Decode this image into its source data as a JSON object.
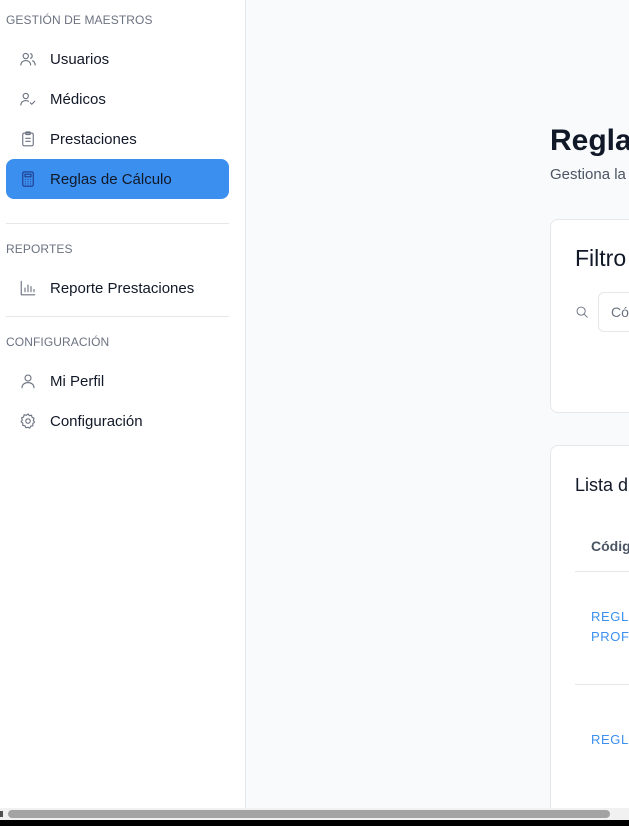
{
  "sidebar": {
    "sections": {
      "gestion": "GESTIÓN DE MAESTROS",
      "reportes": "REPORTES",
      "configuracion": "CONFIGURACIÓN"
    },
    "items": [
      {
        "label": "Usuarios",
        "icon": "users-icon"
      },
      {
        "label": "Médicos",
        "icon": "user-check-icon"
      },
      {
        "label": "Prestaciones",
        "icon": "clipboard-icon"
      },
      {
        "label": "Reglas de Cálculo",
        "icon": "calculator-icon",
        "active": true
      },
      {
        "label": "Reporte Prestaciones",
        "icon": "bar-chart-icon"
      },
      {
        "label": "Mi Perfil",
        "icon": "user-icon"
      },
      {
        "label": "Configuración",
        "icon": "settings-icon"
      }
    ],
    "active_color": "#3b8fef"
  },
  "main": {
    "title": "Regla",
    "subtitle": "Gestiona la",
    "filters": {
      "title": "Filtro",
      "search_placeholder": "Có"
    },
    "list": {
      "title": "Lista d",
      "column_header": "Códig",
      "rows": [
        {
          "line1": "REGLA",
          "line2": "PROFE"
        },
        {
          "line1": "REGLA"
        }
      ]
    },
    "link_color": "#3b8fef"
  }
}
